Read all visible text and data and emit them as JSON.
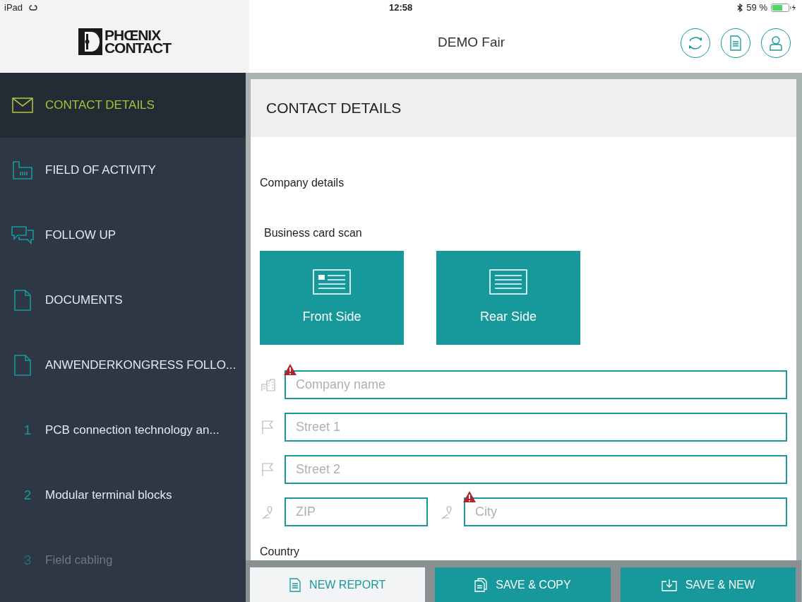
{
  "status_bar": {
    "device": "iPad",
    "time": "12:58",
    "battery": "59 %"
  },
  "header": {
    "title": "DEMO Fair",
    "logo_line1": "PHŒNIX",
    "logo_line2": "CONTACT"
  },
  "sidebar": {
    "items": [
      {
        "kind": "mail",
        "label": "CONTACT DETAILS",
        "selected": true,
        "disabled": false
      },
      {
        "kind": "factory",
        "label": "FIELD OF ACTIVITY",
        "selected": false,
        "disabled": false
      },
      {
        "kind": "chat",
        "label": "FOLLOW UP",
        "selected": false,
        "disabled": false
      },
      {
        "kind": "document",
        "label": "DOCUMENTS",
        "selected": false,
        "disabled": false
      },
      {
        "kind": "document",
        "label": "ANWENDERKONGRESS FOLLO...",
        "selected": false,
        "disabled": false
      },
      {
        "kind": "numbered",
        "number": "1",
        "label": "PCB connection technology an...",
        "selected": false,
        "disabled": false
      },
      {
        "kind": "numbered",
        "number": "2",
        "label": "Modular terminal blocks",
        "selected": false,
        "disabled": false
      },
      {
        "kind": "numbered",
        "number": "3",
        "label": "Field cabling",
        "selected": false,
        "disabled": true
      }
    ]
  },
  "card": {
    "title": "CONTACT DETAILS",
    "section": "Company details",
    "scan_label": "Business card scan",
    "scan_buttons": [
      {
        "kind": "front",
        "label": "Front Side"
      },
      {
        "kind": "rear",
        "label": "Rear Side"
      }
    ],
    "field_rows": [
      [
        {
          "kind": "company",
          "placeholder": "Company name",
          "warning": true
        }
      ],
      [
        {
          "kind": "street",
          "placeholder": "Street 1",
          "warning": false
        }
      ],
      [
        {
          "kind": "street",
          "placeholder": "Street 2",
          "warning": false
        }
      ],
      [
        {
          "kind": "place",
          "placeholder": "ZIP",
          "warning": false
        },
        {
          "kind": "place",
          "placeholder": "City",
          "warning": true
        }
      ]
    ],
    "next_label": "Country"
  },
  "actions": [
    {
      "kind": "report",
      "label": "NEW REPORT"
    },
    {
      "kind": "copy",
      "label": "SAVE & COPY"
    },
    {
      "kind": "save",
      "label": "SAVE & NEW"
    }
  ]
}
